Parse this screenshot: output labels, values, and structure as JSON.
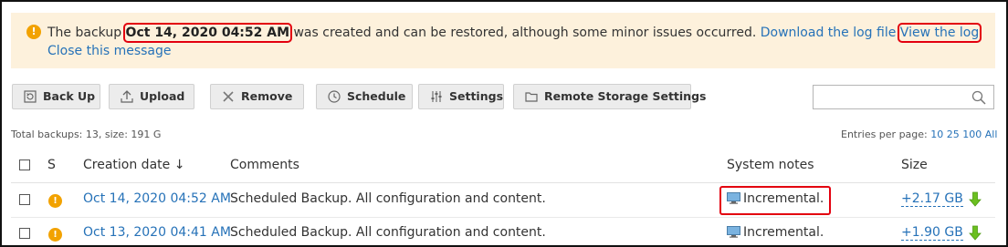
{
  "notice": {
    "text_prefix": "The backup ",
    "backup_date": "Oct 14, 2020 04:52 AM",
    "text_middle": " was created and can be restored, although some minor issues occurred. ",
    "download_log": "Download the log file",
    "view_log": "View the log",
    "close": "Close this message",
    "color": "#fdf1dc"
  },
  "toolbar": {
    "back_up": "Back Up",
    "upload": "Upload",
    "remove": "Remove",
    "schedule": "Schedule",
    "settings": "Settings",
    "remote_storage": "Remote Storage Settings"
  },
  "search": {
    "placeholder": "",
    "icon": "search-icon"
  },
  "summary": "Total backups: 13, size: 191 G",
  "pagination": {
    "label": "Entries per page:",
    "options": [
      "10",
      "25",
      "100",
      "All"
    ]
  },
  "table": {
    "headers": {
      "status": "S",
      "creation_date": "Creation date ↓",
      "comments": "Comments",
      "system_notes": "System notes",
      "size": "Size"
    },
    "rows": [
      {
        "date": "Oct 14, 2020 04:52 AM",
        "comment": "Scheduled Backup. All configuration and content.",
        "note": "Incremental.",
        "size": "+2.17 GB"
      },
      {
        "date": "Oct 13, 2020 04:41 AM",
        "comment": "Scheduled Backup. All configuration and content.",
        "note": "Incremental.",
        "size": "+1.90 GB"
      }
    ]
  },
  "colors": {
    "accent": "#2672b8",
    "warning": "#f2a200",
    "highlight": "#e3000f",
    "download": "#6bbf1f"
  }
}
